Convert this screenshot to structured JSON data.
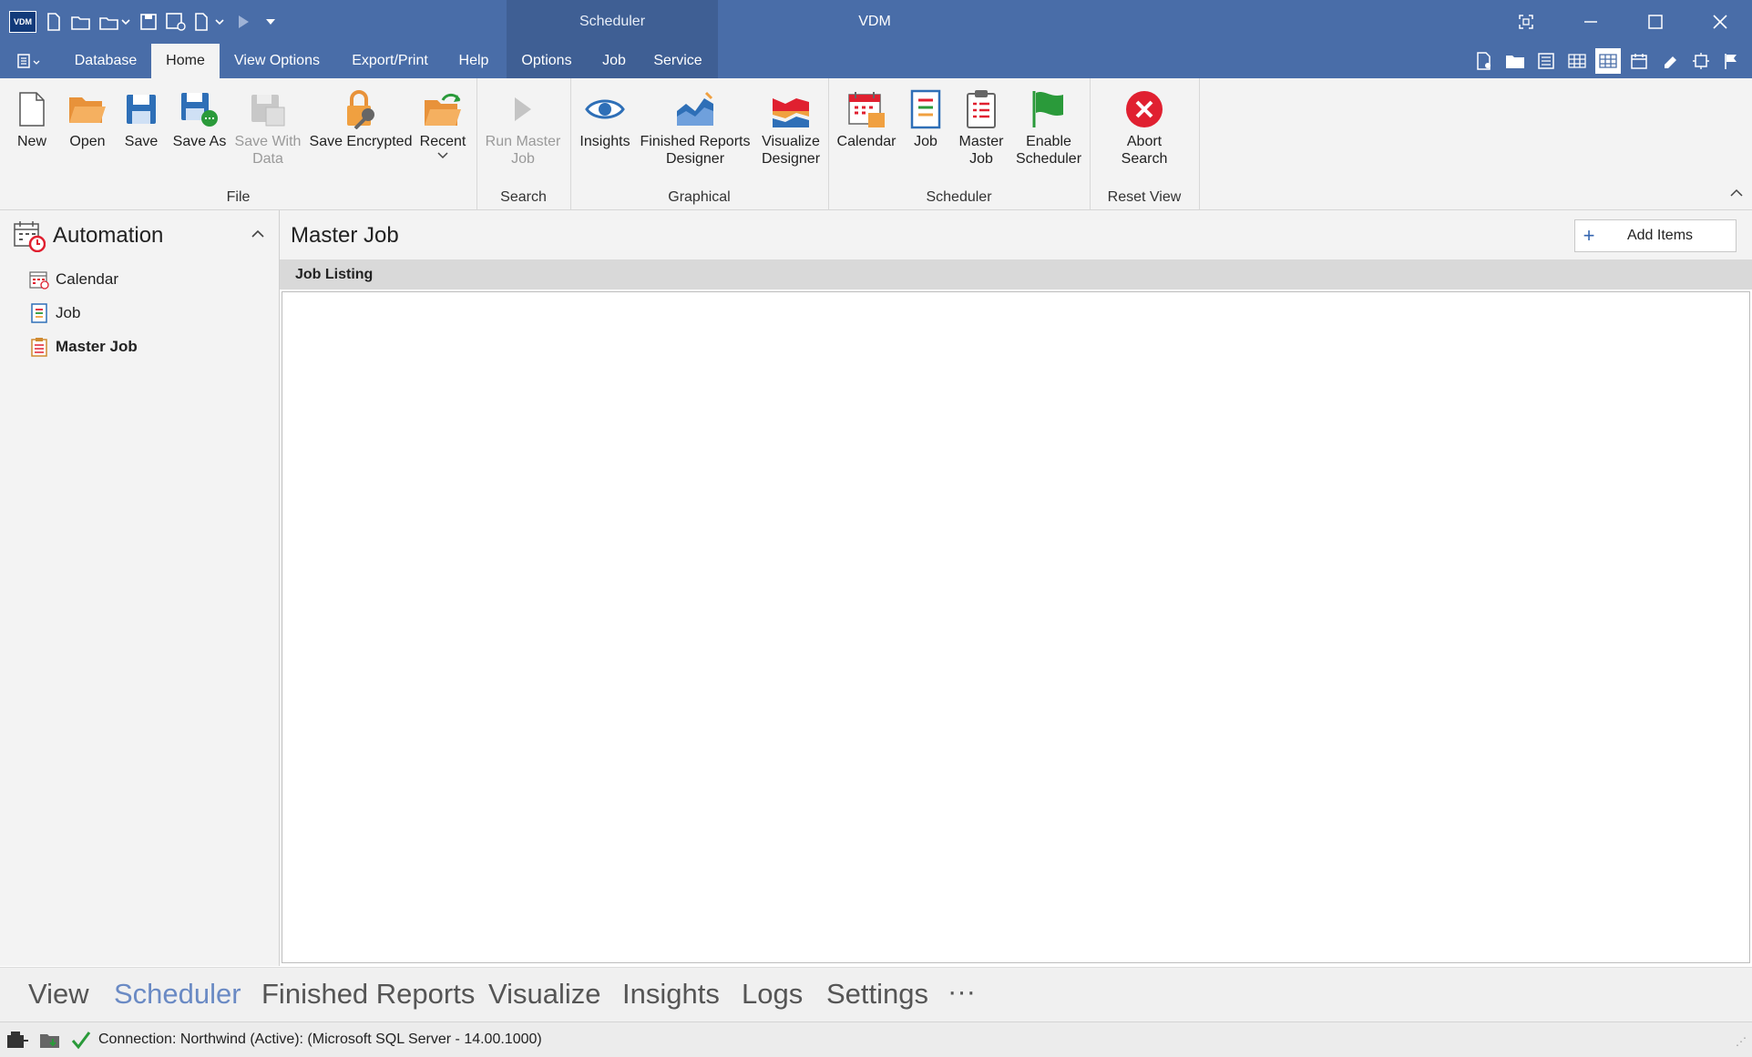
{
  "window": {
    "app_title": "VDM",
    "context_title": "Scheduler",
    "logo_text": "VDM"
  },
  "tabs": {
    "database": "Database",
    "home": "Home",
    "view_options": "View Options",
    "export_print": "Export/Print",
    "help": "Help",
    "options": "Options",
    "job": "Job",
    "service": "Service"
  },
  "ribbon": {
    "file": {
      "label": "File",
      "new": "New",
      "open": "Open",
      "save": "Save",
      "save_as": "Save As",
      "save_with_data_1": "Save With",
      "save_with_data_2": "Data",
      "save_encrypted": "Save Encrypted",
      "recent": "Recent"
    },
    "search": {
      "label": "Search",
      "run_master_job_1": "Run Master",
      "run_master_job_2": "Job"
    },
    "graphical": {
      "label": "Graphical",
      "insights": "Insights",
      "finished_reports_1": "Finished Reports",
      "finished_reports_2": "Designer",
      "visualize_1": "Visualize",
      "visualize_2": "Designer"
    },
    "scheduler": {
      "label": "Scheduler",
      "calendar": "Calendar",
      "job": "Job",
      "master_job_1": "Master",
      "master_job_2": "Job",
      "enable_1": "Enable",
      "enable_2": "Scheduler"
    },
    "reset_view": {
      "label": "Reset View",
      "abort_1": "Abort",
      "abort_2": "Search"
    }
  },
  "sidebar": {
    "title": "Automation",
    "items": [
      "Calendar",
      "Job",
      "Master Job"
    ]
  },
  "main": {
    "title": "Master Job",
    "add_items": "Add Items",
    "list_header": "Job Listing"
  },
  "bottom_nav": [
    "View",
    "Scheduler",
    "Finished Reports",
    "Visualize",
    "Insights",
    "Logs",
    "Settings",
    "···"
  ],
  "status": {
    "connection": "Connection: Northwind (Active): (Microsoft SQL Server - 14.00.1000)"
  },
  "colors": {
    "titlebar": "#496da8",
    "accent_orange": "#f0a040",
    "accent_blue": "#2e6fb7",
    "accent_red": "#e02030",
    "accent_green": "#2a9a3a"
  }
}
